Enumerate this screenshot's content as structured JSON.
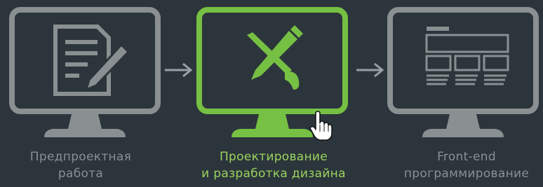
{
  "steps": [
    {
      "id": "pre-project",
      "line1": "Предпроектная",
      "line2": "работа",
      "icon": "document-pen-icon",
      "active": false
    },
    {
      "id": "design",
      "line1": "Проектирование",
      "line2": "и разработка дизайна",
      "icon": "pencil-brush-icon",
      "active": true
    },
    {
      "id": "frontend",
      "line1": "Front-end",
      "line2": "программирование",
      "icon": "wireframe-layout-icon",
      "active": false
    }
  ],
  "colors": {
    "background": "#2b353b",
    "inactive": "#8a8f92",
    "active": "#76c043",
    "active_text": "#9bd35f",
    "arrow": "#9aa0a3"
  },
  "arrow_icon": "arrow-right-icon",
  "cursor_icon": "hand-pointer-icon"
}
